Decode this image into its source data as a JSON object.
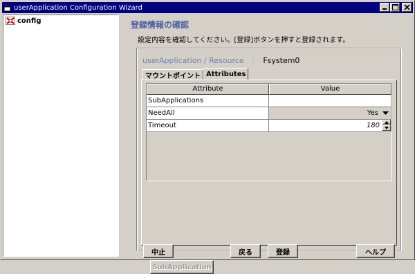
{
  "window": {
    "title": "userApplication Configuration Wizard"
  },
  "tree": {
    "items": [
      {
        "label": "config",
        "icon": "config-node-icon"
      }
    ]
  },
  "page": {
    "heading": "登録情報の確認",
    "description": "設定内容を確認してください。[登録]ボタンを押すと登録されます。"
  },
  "resource": {
    "path": "userApplication / Resource",
    "separator": ":",
    "name": "Fsystem0"
  },
  "tabs": [
    {
      "label": "マウントポイント",
      "active": false
    },
    {
      "label": "Attributes",
      "active": true
    }
  ],
  "table": {
    "headers": [
      "Attribute",
      "Value"
    ],
    "rows": [
      {
        "attribute": "SubApplications",
        "value": ""
      },
      {
        "attribute": "NeedAll",
        "value": "Yes"
      },
      {
        "attribute": "Timeout",
        "value": "180"
      }
    ]
  },
  "buttons": {
    "subapplication": "SubApplication",
    "cancel": "中止",
    "back": "戻る",
    "register": "登録",
    "help": "ヘルプ"
  },
  "colors": {
    "title_bar": "#000080",
    "heading": "#4a5fa0",
    "resource_path": "#6f7fb4",
    "window_bg": "#d4d0c8"
  }
}
